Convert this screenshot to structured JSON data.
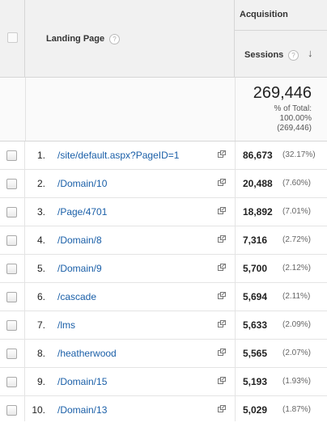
{
  "header": {
    "group_label": "Acquisition",
    "landing_page_label": "Landing Page",
    "sessions_label": "Sessions",
    "help_glyph": "?",
    "sort_glyph": "↓"
  },
  "totals": {
    "value": "269,446",
    "pct_line1": "% of Total:",
    "pct_line2": "100.00%",
    "pct_line3": "(269,446)"
  },
  "rows": [
    {
      "index": "1.",
      "page": "/site/default.aspx?PageID=1",
      "sessions": "86,673",
      "pct": "(32.17%)"
    },
    {
      "index": "2.",
      "page": "/Domain/10",
      "sessions": "20,488",
      "pct": "(7.60%)"
    },
    {
      "index": "3.",
      "page": "/Page/4701",
      "sessions": "18,892",
      "pct": "(7.01%)"
    },
    {
      "index": "4.",
      "page": "/Domain/8",
      "sessions": "7,316",
      "pct": "(2.72%)"
    },
    {
      "index": "5.",
      "page": "/Domain/9",
      "sessions": "5,700",
      "pct": "(2.12%)"
    },
    {
      "index": "6.",
      "page": "/cascade",
      "sessions": "5,694",
      "pct": "(2.11%)"
    },
    {
      "index": "7.",
      "page": "/lms",
      "sessions": "5,633",
      "pct": "(2.09%)"
    },
    {
      "index": "8.",
      "page": "/heatherwood",
      "sessions": "5,565",
      "pct": "(2.07%)"
    },
    {
      "index": "9.",
      "page": "/Domain/15",
      "sessions": "5,193",
      "pct": "(1.93%)"
    },
    {
      "index": "10.",
      "page": "/Domain/13",
      "sessions": "5,029",
      "pct": "(1.87%)"
    }
  ],
  "colors": {
    "link": "#1a5fa8",
    "header_bg": "#f1f1f1"
  }
}
